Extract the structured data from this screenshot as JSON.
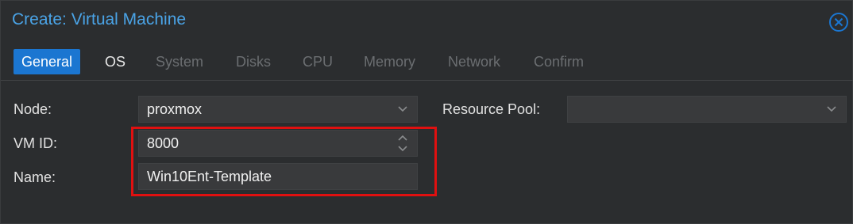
{
  "window": {
    "title": "Create: Virtual Machine",
    "close_icon": "close-circle-icon"
  },
  "tabs": [
    {
      "label": "General",
      "state": "active"
    },
    {
      "label": "OS",
      "state": "enabled"
    },
    {
      "label": "System",
      "state": "disabled"
    },
    {
      "label": "Disks",
      "state": "disabled"
    },
    {
      "label": "CPU",
      "state": "disabled"
    },
    {
      "label": "Memory",
      "state": "disabled"
    },
    {
      "label": "Network",
      "state": "disabled"
    },
    {
      "label": "Confirm",
      "state": "disabled"
    }
  ],
  "form": {
    "node": {
      "label": "Node:",
      "value": "proxmox",
      "icon": "chevron-down-icon"
    },
    "vmid": {
      "label": "VM ID:",
      "value": "8000",
      "icon": "spinner-updown-icon"
    },
    "name": {
      "label": "Name:",
      "value": "Win10Ent-Template"
    },
    "resource_pool": {
      "label": "Resource Pool:",
      "value": "",
      "icon": "chevron-down-icon"
    }
  },
  "annotation": {
    "color": "#e01010"
  },
  "colors": {
    "accent": "#1b76d1",
    "title": "#4aa3e6",
    "background": "#2b2d2f"
  }
}
